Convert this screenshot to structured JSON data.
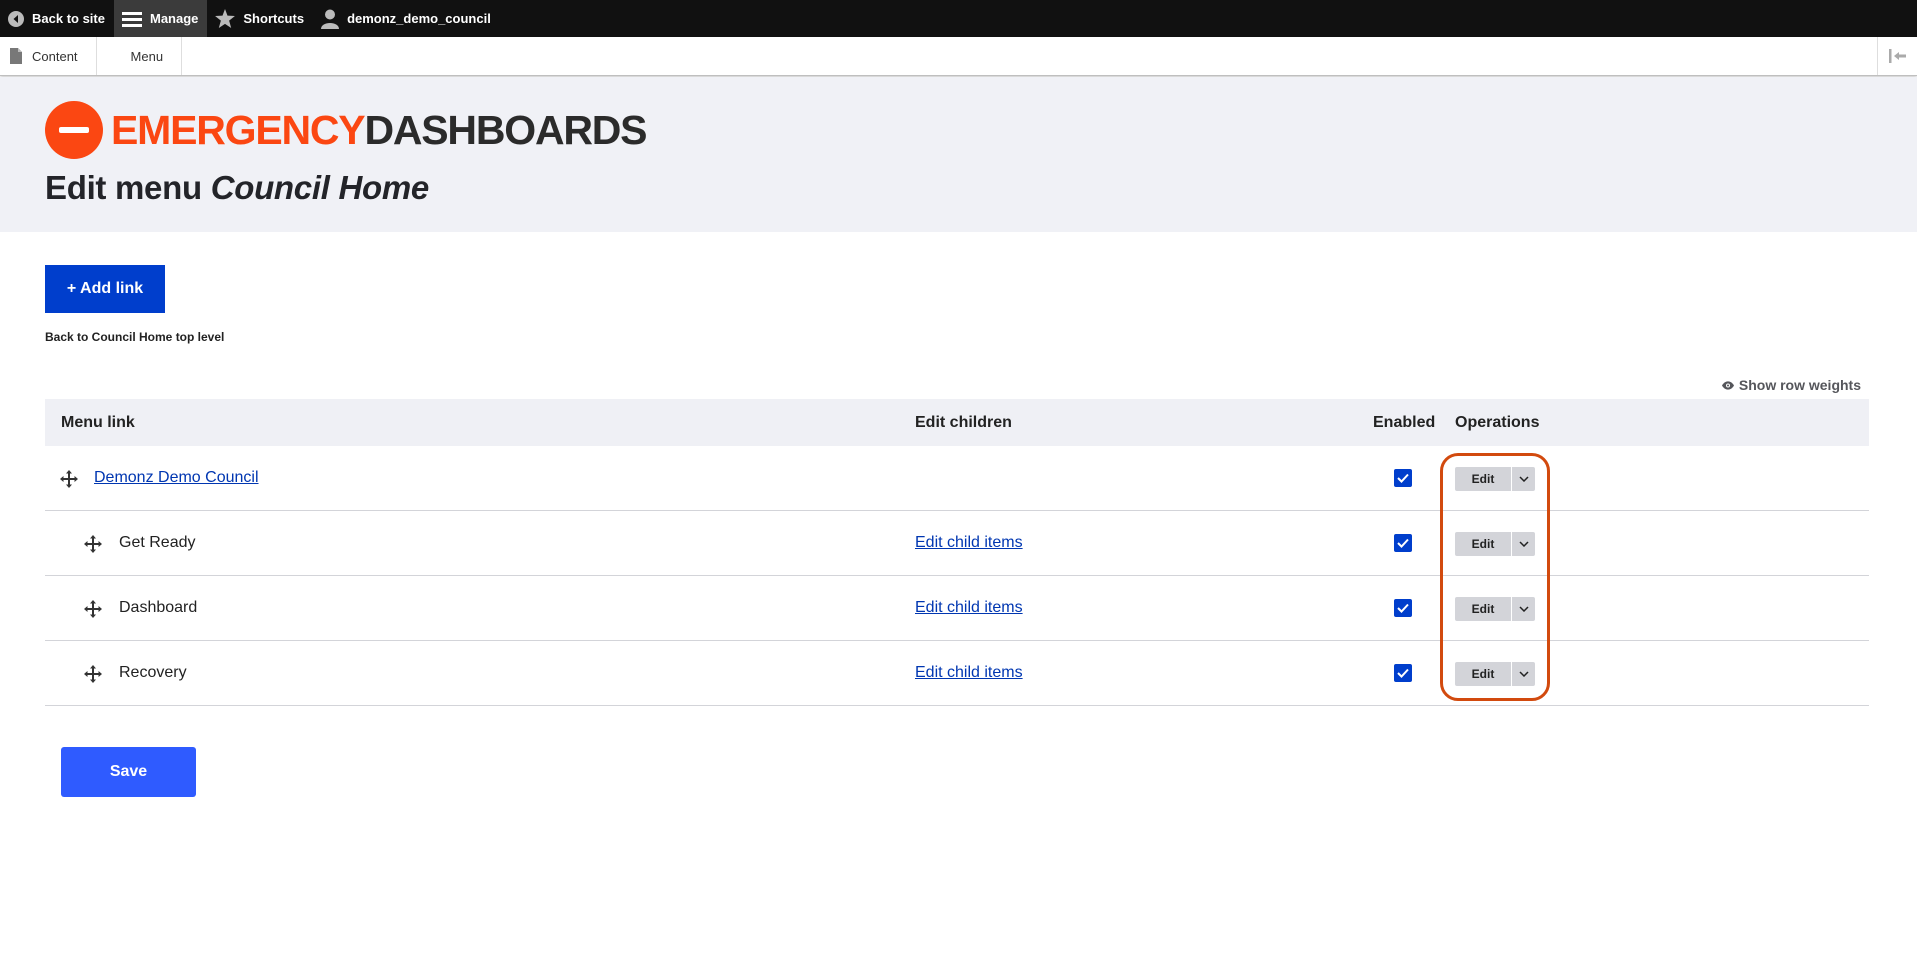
{
  "toolbar": {
    "back_to_site": "Back to site",
    "manage": "Manage",
    "shortcuts": "Shortcuts",
    "user": "demonz_demo_council"
  },
  "tray": {
    "content": "Content",
    "menu": "Menu"
  },
  "logo": {
    "part1": "EMERGENCY",
    "part2": "DASHBOARDS"
  },
  "header": {
    "title_prefix": "Edit menu ",
    "title_menu_name": "Council Home"
  },
  "actions": {
    "add_link": "+ Add link",
    "back_link": "Back to Council Home top level",
    "show_row_weights": "Show row weights",
    "save": "Save"
  },
  "table": {
    "headers": {
      "menu_link": "Menu link",
      "edit_children": "Edit children",
      "enabled": "Enabled",
      "operations": "Operations"
    },
    "rows": [
      {
        "title": "Demonz Demo Council",
        "edit_children": "",
        "enabled": true,
        "edit": "Edit"
      },
      {
        "title": "Get Ready",
        "edit_children": "Edit child items",
        "enabled": true,
        "edit": "Edit"
      },
      {
        "title": "Dashboard",
        "edit_children": "Edit child items",
        "enabled": true,
        "edit": "Edit"
      },
      {
        "title": "Recovery",
        "edit_children": "Edit child items",
        "enabled": true,
        "edit": "Edit"
      }
    ]
  },
  "colors": {
    "toolbar_bg": "#111111",
    "brand_orange": "#fb4712",
    "primary_blue": "#003ecc",
    "save_blue": "#2f5bff",
    "highlight": "#d24a0e"
  }
}
